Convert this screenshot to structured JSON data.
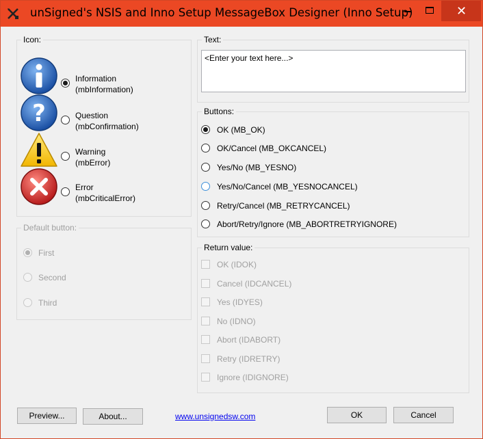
{
  "window": {
    "title": "unSigned's NSIS and Inno Setup MessageBox Designer (Inno Setup)",
    "accent": "#eb4824"
  },
  "icon_group": {
    "legend": "Icon:",
    "options": [
      {
        "icon": "information-icon",
        "line1": "Information",
        "line2": "(mbInformation)",
        "checked": true
      },
      {
        "icon": "question-icon",
        "line1": "Question",
        "line2": "(mbConfirmation)",
        "checked": false
      },
      {
        "icon": "warning-icon",
        "line1": "Warning",
        "line2": "(mbError)",
        "checked": false
      },
      {
        "icon": "error-icon",
        "line1": "Error",
        "line2": "(mbCriticalError)",
        "checked": false
      }
    ]
  },
  "default_button_group": {
    "legend": "Default button:",
    "options": [
      "First",
      "Second",
      "Third"
    ],
    "selected": "First"
  },
  "text_group": {
    "legend": "Text:",
    "value": "<Enter your text here...>"
  },
  "buttons_group": {
    "legend": "Buttons:",
    "options": [
      "OK (MB_OK)",
      "OK/Cancel (MB_OKCANCEL)",
      "Yes/No (MB_YESNO)",
      "Yes/No/Cancel (MB_YESNOCANCEL)",
      "Retry/Cancel (MB_RETRYCANCEL)",
      "Abort/Retry/Ignore (MB_ABORTRETRYIGNORE)"
    ],
    "selected": "OK (MB_OK)"
  },
  "return_group": {
    "legend": "Return value:",
    "options": [
      "OK (IDOK)",
      "Cancel (IDCANCEL)",
      "Yes (IDYES)",
      "No (IDNO)",
      "Abort (IDABORT)",
      "Retry (IDRETRY)",
      "Ignore (IDIGNORE)"
    ]
  },
  "footer": {
    "preview": "Preview...",
    "about": "About...",
    "link": "www.unsignedsw.com",
    "ok": "OK",
    "cancel": "Cancel"
  }
}
